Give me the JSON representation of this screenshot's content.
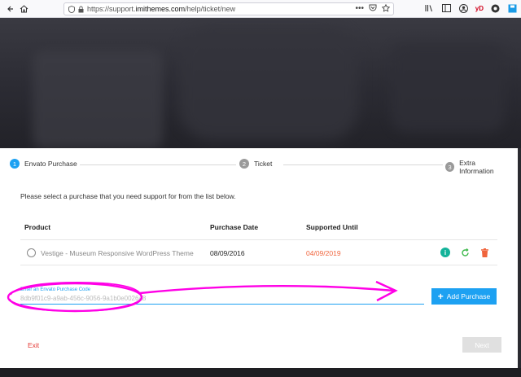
{
  "browser": {
    "url_scheme": "https://support.",
    "url_host": "imithemes.com",
    "url_path": "/help/ticket/new",
    "menu_dots": "•••",
    "profile_label": "yD"
  },
  "stepper": {
    "steps": [
      {
        "num": "1",
        "label": "Envato Purchase"
      },
      {
        "num": "2",
        "label": "Ticket"
      },
      {
        "num": "3",
        "label": "Extra Information"
      }
    ]
  },
  "instruction": "Please select a purchase that you need support for from the list below.",
  "table": {
    "headers": [
      "Product",
      "Purchase Date",
      "Supported Until"
    ],
    "rows": [
      {
        "product": "Vestige - Museum Responsive WordPress Theme",
        "purchase_date": "08/09/2016",
        "supported_until": "04/09/2019"
      }
    ]
  },
  "purchase_code": {
    "label": "Enter an Envato Purchase Code",
    "value": "8db9f01c9-a9ab-456c-9056-9a1b0e0026a8"
  },
  "add_button_label": "Add Purchase",
  "exit_label": "Exit",
  "next_label": "Next",
  "colors": {
    "accent": "#1da1f2",
    "supported_until": "#f0643c",
    "exit": "#e53935",
    "annotation": "#ff00e6"
  }
}
